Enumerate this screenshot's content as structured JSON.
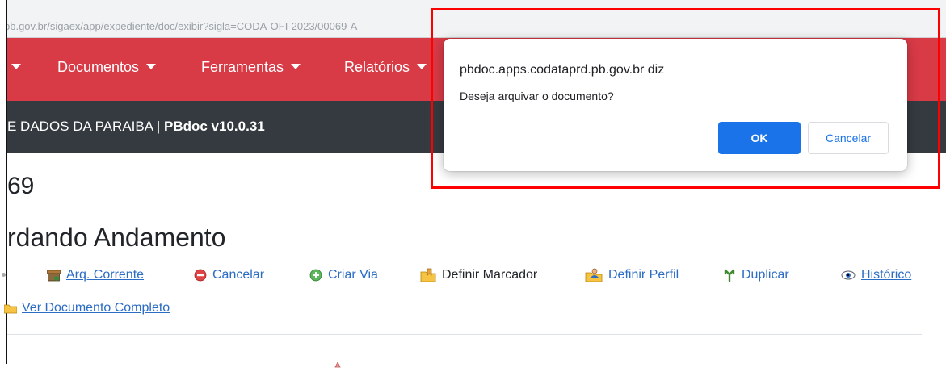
{
  "browser": {
    "url_fragment": "pb.gov.br/sigaex/app/expediente/doc/exibir?sigla=CODA-OFI-2023/00069-A"
  },
  "navbar": {
    "items": [
      {
        "label": "Documentos"
      },
      {
        "label": "Ferramentas"
      },
      {
        "label": "Relatórios"
      }
    ]
  },
  "subbar": {
    "org_text": "E DADOS DA PARAIBA | ",
    "version": "PBdoc v10.0.31"
  },
  "document": {
    "number": "69",
    "status": "rdando Andamento"
  },
  "actions": [
    {
      "label": "Arq. Corrente",
      "icon": "archive-box-icon"
    },
    {
      "label": "Cancelar",
      "icon": "cancel-circle-icon"
    },
    {
      "label": "Criar Via",
      "icon": "add-circle-icon"
    },
    {
      "label": "Definir Marcador",
      "icon": "folder-tag-icon"
    },
    {
      "label": "Definir Perfil",
      "icon": "folder-user-icon"
    },
    {
      "label": "Duplicar",
      "icon": "duplicate-icon"
    },
    {
      "label": "Histórico",
      "icon": "eye-icon"
    }
  ],
  "view_full": {
    "label": "Ver Documento Completo",
    "icon": "folder-icon"
  },
  "dialog": {
    "title": "pbdoc.apps.codataprd.pb.gov.br diz",
    "message": "Deseja arquivar o documento?",
    "ok_label": "OK",
    "cancel_label": "Cancelar"
  },
  "colors": {
    "navbar": "#d83a46",
    "subbar": "#343a40",
    "link": "#2b6cc4",
    "dialog_primary": "#1a73e8",
    "highlight": "#ff0000"
  }
}
